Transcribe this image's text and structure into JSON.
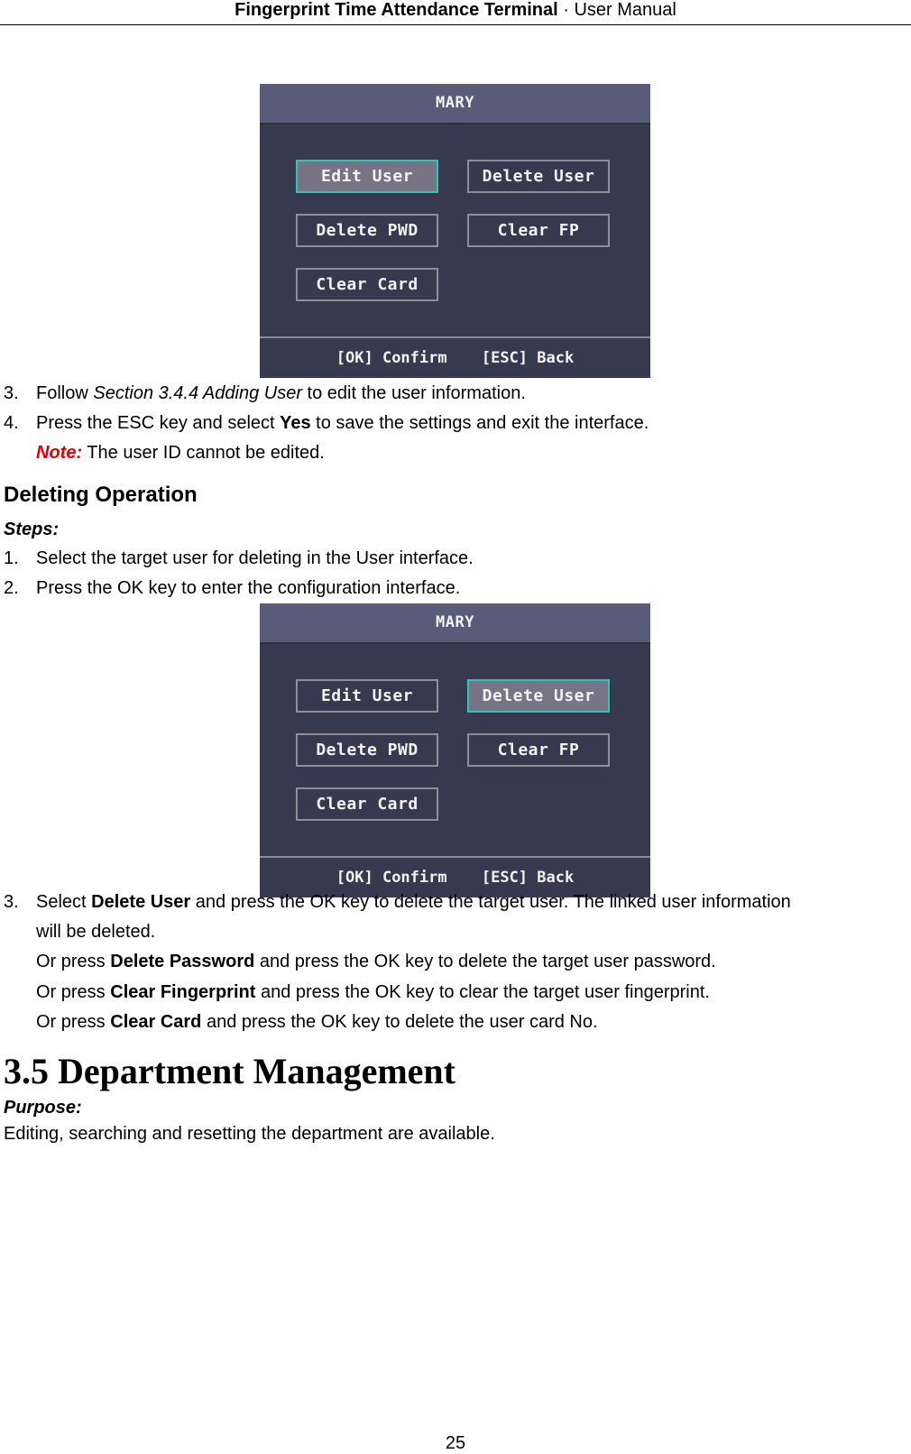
{
  "header": {
    "title_bold": "Fingerprint Time Attendance Terminal",
    "separator": "·",
    "title_regular": "User Manual"
  },
  "screen1": {
    "title": "MARY",
    "buttons": [
      "Edit User",
      "Delete User",
      "Delete PWD",
      "Clear FP",
      "Clear Card"
    ],
    "selected": "Edit User",
    "footer_confirm": "[OK] Confirm",
    "footer_back": "[ESC] Back"
  },
  "editing_steps": [
    {
      "num": "3.",
      "pre": "Follow ",
      "italic": "Section 3.4.4 Adding User",
      "post": " to edit the user information."
    },
    {
      "num": "4.",
      "pre": "Press the ESC key and select ",
      "bold": "Yes",
      "post": " to save the settings and exit the interface."
    }
  ],
  "note": {
    "label": "Note:",
    "text": " The user ID cannot be edited."
  },
  "deleting": {
    "heading": "Deleting Operation",
    "steps_label": "Steps:",
    "steps": [
      {
        "num": "1.",
        "text": "Select the target user for deleting in the User interface."
      },
      {
        "num": "2.",
        "text": "Press the OK key to enter the configuration interface."
      }
    ]
  },
  "screen2": {
    "title": "MARY",
    "buttons": [
      "Edit User",
      "Delete User",
      "Delete PWD",
      "Clear FP",
      "Clear Card"
    ],
    "selected": "Delete User",
    "footer_confirm": "[OK] Confirm",
    "footer_back": "[ESC] Back"
  },
  "step3": {
    "num": "3.",
    "line1_pre": "Select ",
    "line1_bold": "Delete User",
    "line1_post": " and press the OK key to delete the target user. The linked user information",
    "line2": "will be deleted.",
    "or_lines": [
      {
        "pre": "Or press ",
        "bold": "Delete Password",
        "post": " and press the OK key to delete the target user password."
      },
      {
        "pre": "Or press ",
        "bold": "Clear Fingerprint",
        "post": " and press the OK key to clear the target user fingerprint."
      },
      {
        "pre": "Or press ",
        "bold": "Clear Card",
        "post": " and press the OK key to delete the user card No."
      }
    ]
  },
  "section": {
    "title": "3.5 Department Management",
    "purpose_label": "Purpose:",
    "purpose_text": "Editing, searching and resetting the department are available."
  },
  "page_number": "25"
}
